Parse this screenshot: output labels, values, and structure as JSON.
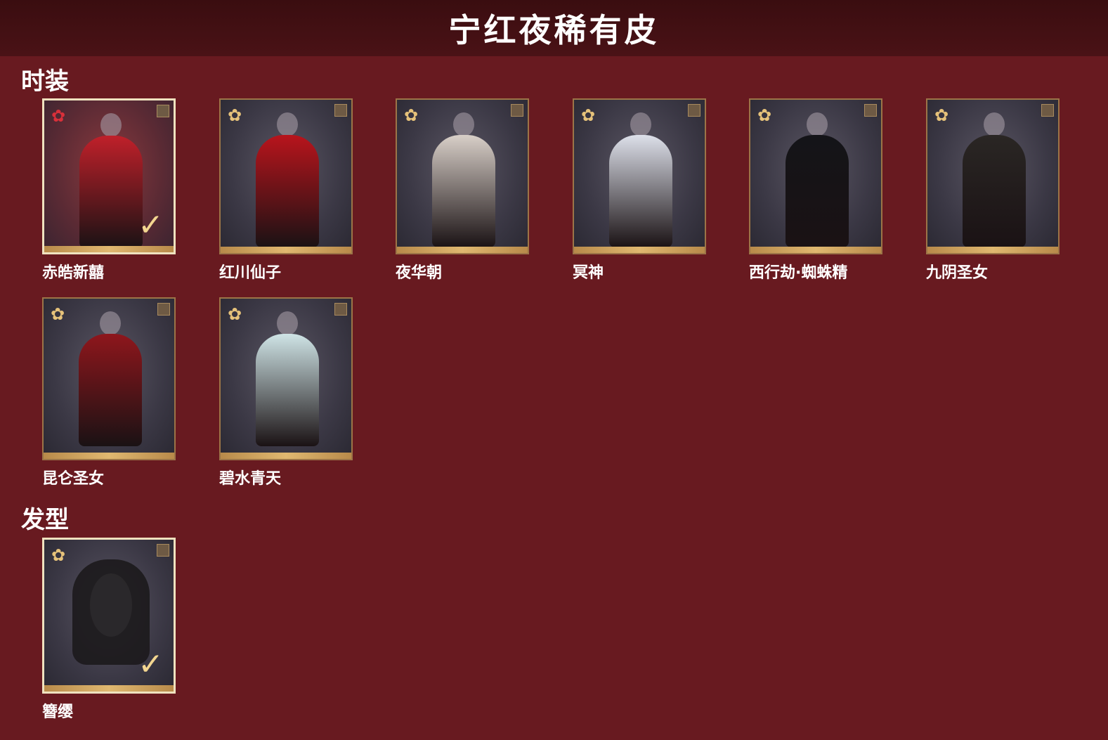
{
  "header": {
    "title": "宁红夜稀有皮"
  },
  "sections": {
    "outfits": {
      "title": "时装",
      "items": [
        {
          "name": "赤皓新囍",
          "selected": true,
          "icon": "red-flower-icon",
          "color": "#c0202a"
        },
        {
          "name": "红川仙子",
          "selected": false,
          "icon": "gold-flower-icon",
          "color": "#b8141c"
        },
        {
          "name": "夜华朝",
          "selected": false,
          "icon": "gold-flower-icon",
          "color": "#d8cfc8"
        },
        {
          "name": "冥神",
          "selected": false,
          "icon": "gold-flower-icon",
          "color": "#dde0ea"
        },
        {
          "name": "西行劫·蜘蛛精",
          "selected": false,
          "icon": "gold-flower-icon",
          "color": "#141418"
        },
        {
          "name": "九阴圣女",
          "selected": false,
          "icon": "gold-flower-icon",
          "color": "#2a2624"
        },
        {
          "name": "昆仑圣女",
          "selected": false,
          "icon": "gold-flower-icon",
          "color": "#8e161c"
        },
        {
          "name": "碧水青天",
          "selected": false,
          "icon": "gold-flower-icon",
          "color": "#cfe4e6"
        }
      ]
    },
    "hairstyles": {
      "title": "发型",
      "items": [
        {
          "name": "簪缨",
          "selected": true,
          "icon": "gold-flower-icon",
          "color": "#1c1a1c"
        }
      ]
    }
  },
  "icons": {
    "flower": "✿",
    "check": "✓"
  },
  "colors": {
    "background": "#681a20",
    "header": "#3a0d10",
    "frame": "#9c7447",
    "selected_frame": "#efe2bf"
  }
}
